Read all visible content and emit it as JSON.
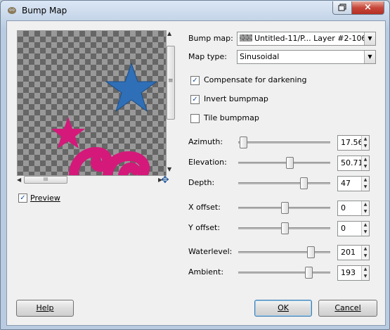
{
  "window": {
    "title": "Bump Map",
    "close_glyph": "×"
  },
  "preview": {
    "label": "Preview",
    "checked": true,
    "checkmark": "✓",
    "hscroll_thumb_glyph": "III",
    "vscroll_thumb_glyph": "≡",
    "nav_icon": "✥"
  },
  "bump_map": {
    "label": "Bump map:",
    "value": "Untitled-11/P... Layer #2-106",
    "arrow": "▼"
  },
  "map_type": {
    "label": "Map type:",
    "value": "Sinusoidal",
    "arrow": "▼"
  },
  "checkboxes": [
    {
      "label": "Compensate for darkening",
      "checked": true,
      "mark": "✓"
    },
    {
      "label": "Invert bumpmap",
      "checked": true,
      "mark": "✓"
    },
    {
      "label": "Tile bumpmap",
      "checked": false,
      "mark": ""
    }
  ],
  "sliders": [
    {
      "label": "Azimuth:",
      "value": "17.56",
      "fraction": 0.05
    },
    {
      "label": "Elevation:",
      "value": "50.71",
      "fraction": 0.56
    },
    {
      "label": "Depth:",
      "value": "47",
      "fraction": 0.71
    },
    {
      "label": "X offset:",
      "value": "0",
      "fraction": 0.5
    },
    {
      "label": "Y offset:",
      "value": "0",
      "fraction": 0.5
    },
    {
      "label": "Waterlevel:",
      "value": "201",
      "fraction": 0.79
    },
    {
      "label": "Ambient:",
      "value": "193",
      "fraction": 0.76
    }
  ],
  "spin_arrows": "▲▼",
  "buttons": {
    "help": "Help",
    "ok": "OK",
    "cancel": "Cancel"
  },
  "colors": {
    "star_blue": "#2f6fb7",
    "star_magenta": "#d4197a"
  }
}
